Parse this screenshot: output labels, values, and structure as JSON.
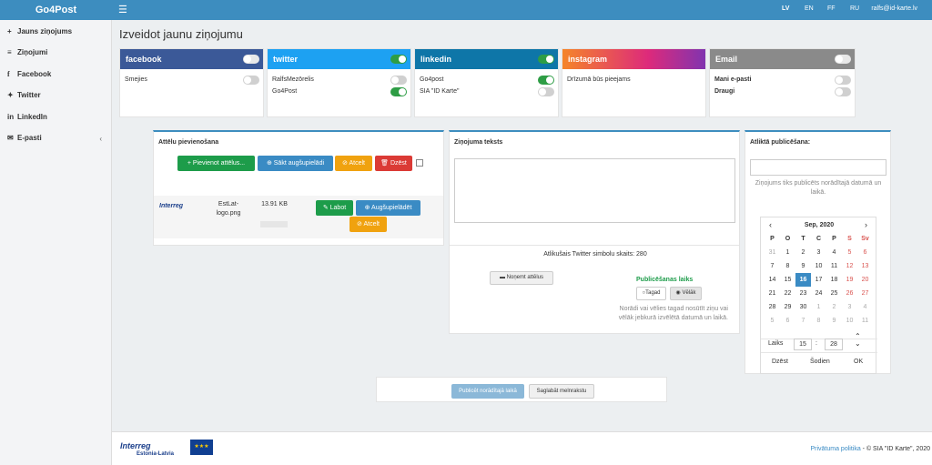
{
  "topbar": {
    "brand": "Go4Post",
    "menu_icon": "hamburger-icon",
    "langs": [
      "LV",
      "EN",
      "FF",
      "RU"
    ],
    "active_lang": "LV",
    "user": "ralfs@id-karte.lv"
  },
  "sidebar": {
    "items": [
      {
        "icon": "plus-icon",
        "label": "Jauns ziņojums"
      },
      {
        "icon": "list-icon",
        "label": "Ziņojumi"
      },
      {
        "icon": "facebook-icon",
        "label": "Facebook"
      },
      {
        "icon": "twitter-icon",
        "label": "Twitter"
      },
      {
        "icon": "linkedin-icon",
        "label": "LinkedIn"
      },
      {
        "icon": "envelope-icon",
        "label": "E-pasti"
      }
    ]
  },
  "page_title": "Izveidot jaunu ziņojumu",
  "channels": {
    "facebook": {
      "title": "facebook",
      "color": "#3b5998",
      "enabled": false,
      "accounts": [
        {
          "name": "Smejies",
          "on": false
        }
      ]
    },
    "twitter": {
      "title": "twitter",
      "color": "#1da1f2",
      "enabled": true,
      "accounts": [
        {
          "name": "RalfsMezōrelis",
          "on": false
        },
        {
          "name": "Go4Post",
          "on": true
        }
      ]
    },
    "linkedin": {
      "title": "linkedin",
      "color": "#0e76a8",
      "enabled": true,
      "accounts": [
        {
          "name": "Go4post",
          "on": true
        },
        {
          "name": "SIA \"ID Karte\"",
          "on": false
        }
      ]
    },
    "instagram": {
      "title": "instagram",
      "enabled": false,
      "message": "Drīzumā būs pieejams"
    },
    "email": {
      "title": "Email",
      "color": "#8a8a8a",
      "enabled": false,
      "accounts": [
        {
          "name": "Mani e-pasti",
          "on": false
        },
        {
          "name": "Draugi",
          "on": false
        }
      ]
    }
  },
  "images": {
    "title": "Attēlu pievienošana",
    "add": "Pievienot attēlus...",
    "start_upload": "Sākt augšupielādi",
    "cancel": "Atcelt",
    "delete": "Dzēst",
    "file": {
      "name": "EstLat-logo.png",
      "size": "13.91 KB",
      "thumb_text": "Interreg",
      "edit": "Labot",
      "upload": "Augšupielādēt",
      "cancel": "Atcelt"
    }
  },
  "message": {
    "title": "Ziņojuma teksts",
    "remaining": "Atlikušais Twitter simbolu skaits: 280",
    "remove_images": "Noņemt attēlus",
    "pub_time_label": "Publicēšanas laiks",
    "now": "Tagad",
    "later": "Vēlāk",
    "hint": "Norādi vai vēlies tagad nosūtīt ziņu vai vēlāk jebkurā izvēlētā datumā un laikā."
  },
  "scheduled": {
    "title": "Atliktā publicēšana:",
    "hint": "Ziņojums tiks publicēts norādītajā datumā un laikā.",
    "month": "Sep, 2020",
    "weekdays": [
      "P",
      "O",
      "T",
      "C",
      "P",
      "S",
      "Sv"
    ],
    "weeks": [
      [
        "31",
        "1",
        "2",
        "3",
        "4",
        "5",
        "6"
      ],
      [
        "7",
        "8",
        "9",
        "10",
        "11",
        "12",
        "13"
      ],
      [
        "14",
        "15",
        "16",
        "17",
        "18",
        "19",
        "20"
      ],
      [
        "21",
        "22",
        "23",
        "24",
        "25",
        "26",
        "27"
      ],
      [
        "28",
        "29",
        "30",
        "1",
        "2",
        "3",
        "4"
      ],
      [
        "5",
        "6",
        "7",
        "8",
        "9",
        "10",
        "11"
      ]
    ],
    "selected": "16",
    "time_label": "Laiks",
    "hour": "15",
    "minute": "28",
    "clear": "Dzēst",
    "today": "Šodien",
    "ok": "OK"
  },
  "actions": {
    "publish": "Publicēt norādītajā laikā",
    "save_draft": "Saglabāt melnrakstu"
  },
  "footer": {
    "logo_text": "Interreg",
    "logo_sub": "Estonia-Latvia",
    "privacy": "Privātuma politika",
    "copyright": "- © SIA \"ID Karte\", 2020"
  }
}
